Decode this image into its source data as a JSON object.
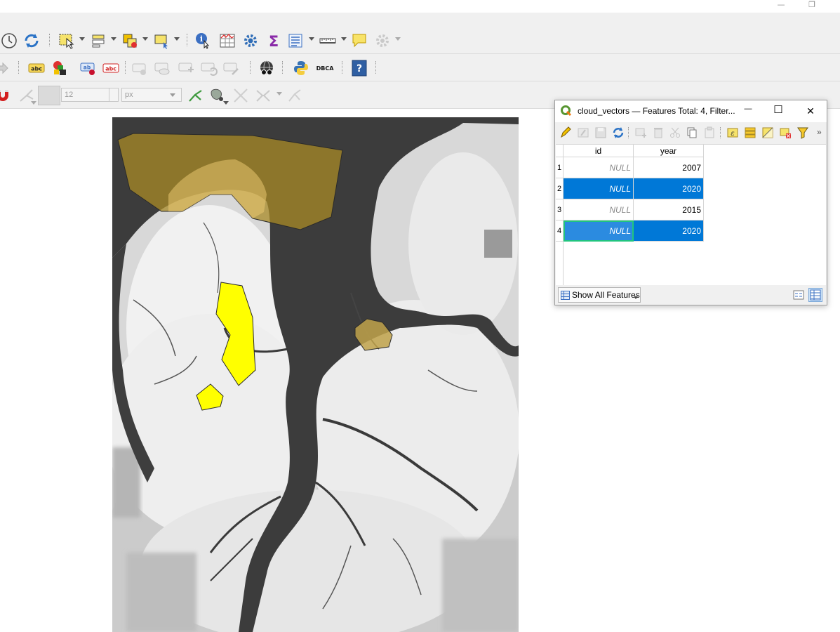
{
  "window": {
    "minimize_glyph": "—",
    "restore_glyph": "❐"
  },
  "toolbars": {
    "digitizing": {
      "snapping_tolerance_value": "12",
      "snapping_units": "px"
    },
    "label_icons": {
      "abc": "abc",
      "dbca": "DBCA"
    }
  },
  "attribute_table": {
    "title": "cloud_vectors — Features Total: 4, Filter...",
    "minimize_glyph": "—",
    "maximize_glyph": "☐",
    "close_glyph": "✕",
    "more_glyph": "»",
    "columns": [
      "id",
      "year"
    ],
    "rows": [
      {
        "row": "1",
        "id": "NULL",
        "year": "2007",
        "selected": false
      },
      {
        "row": "2",
        "id": "NULL",
        "year": "2020",
        "selected": true
      },
      {
        "row": "3",
        "id": "NULL",
        "year": "2015",
        "selected": false
      },
      {
        "row": "4",
        "id": "NULL",
        "year": "2020",
        "selected": true,
        "current": true
      }
    ],
    "filter_button": "Show All Features"
  },
  "colors": {
    "selection_blue": "#0078d7",
    "current_cell_border": "#22c57e",
    "cloud_polygon_yellow": "#ffff00",
    "cloud_polygon_brown": "#a88a25"
  },
  "icons": [
    "clock-icon",
    "refresh-icon",
    "select-features-icon",
    "select-by-attribute-icon",
    "deselect-icon",
    "select-location-icon",
    "identify-icon",
    "attribute-table-icon",
    "settings-icon",
    "statistics-sigma-icon",
    "field-calculator-icon",
    "measure-icon",
    "map-tips-icon",
    "label-icon",
    "python-icon",
    "help-icon"
  ]
}
